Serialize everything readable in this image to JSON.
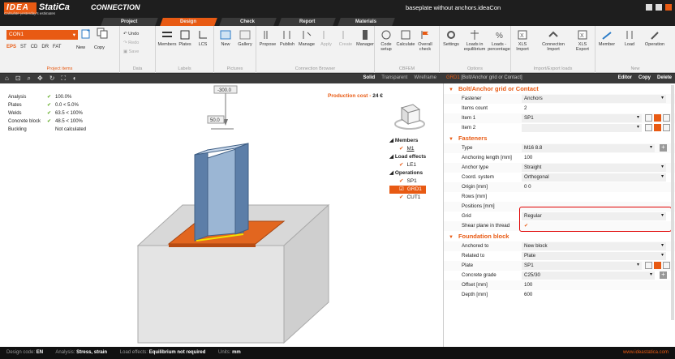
{
  "app": {
    "logo": "IDEA",
    "product": "StatiCa",
    "module": "CONNECTION",
    "tagline": "Calculate yesterday's estimates",
    "filename": "baseplate without anchors.ideaCon"
  },
  "tabs": [
    "Project",
    "Design",
    "Check",
    "Report",
    "Materials"
  ],
  "ribbon": {
    "project_items": {
      "selector": "CON1",
      "codes": [
        "EPS",
        "ST",
        "CD",
        "DR",
        "FAT"
      ],
      "new": "New",
      "copy": "Copy",
      "label": "Project items"
    },
    "data": {
      "undo": "Undo",
      "redo": "Redo",
      "save": "Save",
      "label": "Data"
    },
    "labels": {
      "members": "Members",
      "plates": "Plates",
      "lcs": "LCS",
      "label": "Labels"
    },
    "pictures": {
      "new": "New",
      "gallery": "Gallery",
      "label": "Pictures"
    },
    "browser": {
      "propose": "Propose",
      "publish": "Publish",
      "manage": "Manage",
      "apply": "Apply",
      "create": "Create",
      "manager": "Manager",
      "label": "Connection Browser"
    },
    "cbfem": {
      "code_setup": "Code setup",
      "calculate": "Calculate",
      "overall_check": "Overall check",
      "label": "CBFEM"
    },
    "options": {
      "settings": "Settings",
      "loads_eq": "Loads in equilibrium",
      "loads_pct": "Loads - percentage",
      "label": "Options"
    },
    "import_export": {
      "xls_import": "XLS Import",
      "conn_import": "Connection Import",
      "xls_export": "XLS Export",
      "label": "Import/Export loads"
    },
    "new_group": {
      "member": "Member",
      "load": "Load",
      "operation": "Operation",
      "label": "New"
    }
  },
  "viewport": {
    "modes": [
      "Solid",
      "Transparent",
      "Wireframe"
    ],
    "active_mode": "Solid",
    "production_cost_label": "Production cost",
    "production_cost_value": "24 €",
    "load_top": "-300.0",
    "load_side": "50.0"
  },
  "checks": [
    {
      "label": "Analysis",
      "status": "ok",
      "value": "100.0%"
    },
    {
      "label": "Plates",
      "status": "ok",
      "value": "0.0 < 5.0%"
    },
    {
      "label": "Welds",
      "status": "ok",
      "value": "63.5 < 100%"
    },
    {
      "label": "Concrete block",
      "status": "ok",
      "value": "48.5 < 100%"
    },
    {
      "label": "Buckling",
      "status": "none",
      "value": "Not calculated"
    }
  ],
  "tree": {
    "members_label": "Members",
    "members": [
      "M1"
    ],
    "load_effects_label": "Load effects",
    "load_effects": [
      "LE1"
    ],
    "operations_label": "Operations",
    "operations": [
      "SP1",
      "GRD1",
      "CUT1"
    ],
    "selected": "GRD1"
  },
  "panel": {
    "title": "GRD1",
    "subtitle": "[Bolt/Anchor grid or Contact]",
    "editor": "Editor",
    "copy": "Copy",
    "delete": "Delete",
    "sections": {
      "grid": "Bolt/Anchor grid or Contact",
      "fasteners": "Fasteners",
      "foundation": "Foundation block"
    },
    "grid_rows": {
      "fastener_k": "Fastener",
      "fastener_v": "Anchors",
      "count_k": "Items count",
      "count_v": "2",
      "item1_k": "Item 1",
      "item1_v": "SP1",
      "item2_k": "Item 2",
      "item2_v": ""
    },
    "fastener_rows": {
      "type_k": "Type",
      "type_v": "M16 8.8",
      "anch_k": "Anchoring length [mm]",
      "anch_v": "100",
      "atype_k": "Anchor type",
      "atype_v": "Straight",
      "coord_k": "Coord. system",
      "coord_v": "Orthogonal",
      "origin_k": "Origin [mm]",
      "origin_v": "0 0",
      "rows_k": "Rows [mm]",
      "rows_v": "",
      "pos_k": "Positions [mm]",
      "pos_v": "",
      "grid_k": "Grid",
      "grid_v": "Regular",
      "shear_k": "Shear plane in thread",
      "shear_v": "✔"
    },
    "foundation_rows": {
      "anch_to_k": "Anchored to",
      "anch_to_v": "New block",
      "rel_k": "Related to",
      "rel_v": "Plate",
      "plate_k": "Plate",
      "plate_v": "SP1",
      "grade_k": "Concrete grade",
      "grade_v": "C25/30",
      "offset_k": "Offset [mm]",
      "offset_v": "100",
      "depth_k": "Depth [mm]",
      "depth_v": "600"
    }
  },
  "status": {
    "design_code_label": "Design code:",
    "design_code": "EN",
    "analysis_label": "Analysis:",
    "analysis": "Stress, strain",
    "load_effects_label": "Load effects:",
    "load_effects": "Equilibrium not required",
    "units_label": "Units:",
    "units": "mm",
    "url": "www.ideastatica.com"
  },
  "colors": {
    "accent": "#e85a13",
    "ok": "#58a618",
    "highlight": "#e00000"
  }
}
